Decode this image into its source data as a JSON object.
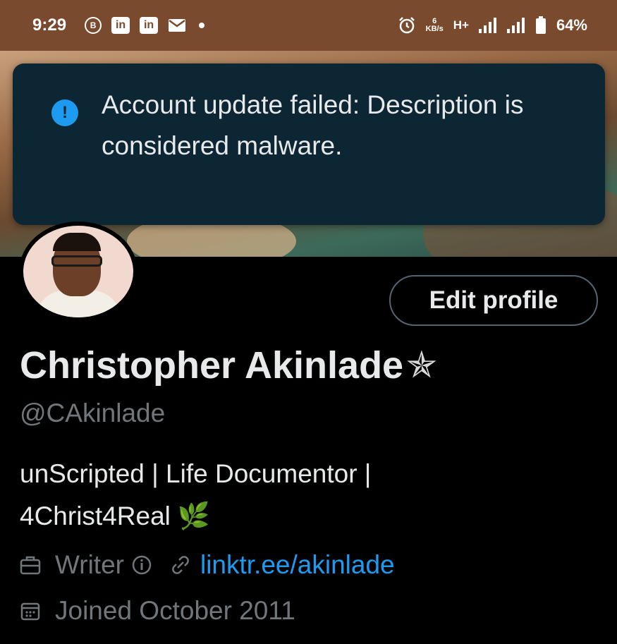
{
  "status_bar": {
    "time": "9:29",
    "notification_icons": [
      "b-badge-icon",
      "linkedin-icon",
      "linkedin-icon",
      "mail-icon",
      "dot-icon"
    ],
    "linkedin_label": "in",
    "b_label": "B",
    "network_speed_value": "6",
    "network_speed_unit": "KB/s",
    "network_type": "H+",
    "battery": "64%"
  },
  "toast": {
    "icon": "alert-icon",
    "icon_glyph": "!",
    "message": "Account update failed: Description is considered malware."
  },
  "profile": {
    "edit_button": "Edit profile",
    "name": "Christopher Akinlade",
    "name_suffix": "✯",
    "handle": "@CAkinlade",
    "bio_line1": "unScripted | Life Documentor |",
    "bio_line2": "4Christ4Real",
    "bio_emoji": "🌿",
    "category": "Writer",
    "link": "linktr.ee/akinlade",
    "joined": "Joined October 2011"
  },
  "colors": {
    "accent": "#1d9bf0",
    "toast_bg": "#0d2633",
    "status_bar_bg": "#7a4a2e",
    "muted_text": "#71767b"
  }
}
